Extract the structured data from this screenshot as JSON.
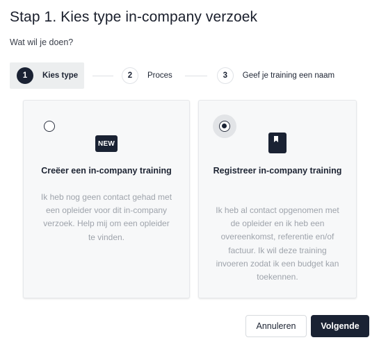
{
  "header": {
    "title": "Stap 1. Kies type in-company verzoek",
    "subtitle": "Wat wil je doen?"
  },
  "stepper": {
    "steps": [
      {
        "number": "1",
        "label": "Kies type",
        "active": true
      },
      {
        "number": "2",
        "label": "Proces",
        "active": false
      },
      {
        "number": "3",
        "label": "Geef je training een naam",
        "active": false
      }
    ]
  },
  "options": [
    {
      "icon": "new-badge-icon",
      "icon_text": "NEW",
      "title": "Creëer een in-company training",
      "description": "Ik heb nog geen contact gehad met een opleider voor dit in-company verzoek. Help mij om een opleider te vinden.",
      "selected": false
    },
    {
      "icon": "book-icon",
      "title": "Registreer in-company training",
      "description": "Ik heb al contact opgenomen met de opleider en ik heb een overeenkomst, referentie en/of factuur. Ik wil deze training invoeren zodat ik een budget kan toekennen.",
      "selected": true
    }
  ],
  "footer": {
    "cancel_label": "Annuleren",
    "next_label": "Volgende"
  },
  "colors": {
    "primary": "#1a2233",
    "card_bg": "#f7f8f9",
    "muted_text": "#9ea3ab"
  }
}
